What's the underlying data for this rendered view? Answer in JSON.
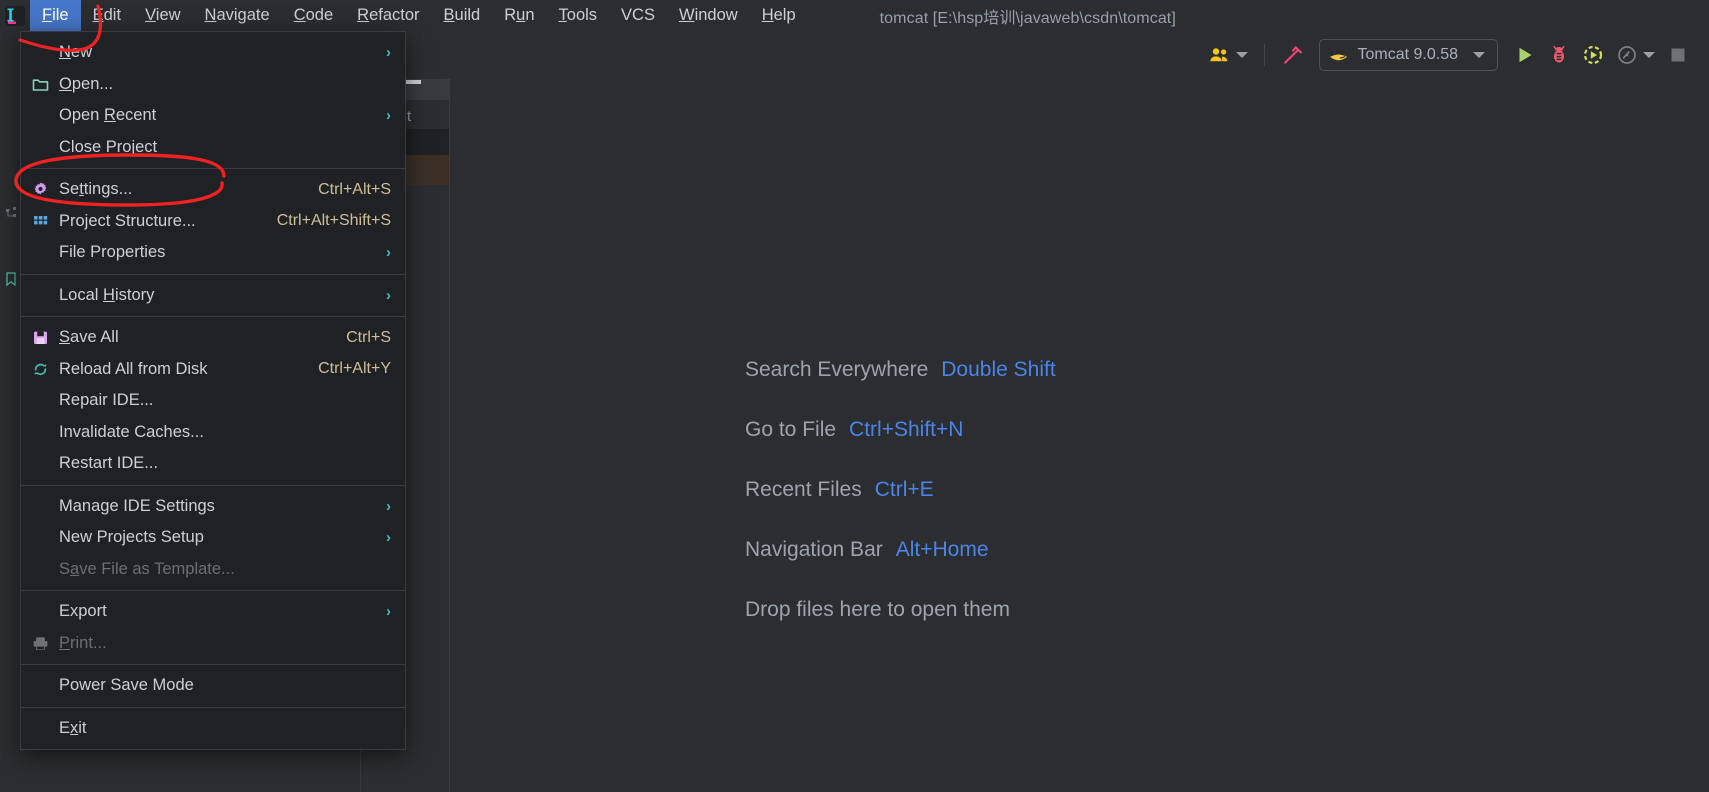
{
  "window": {
    "title": "tomcat [E:\\hsp培训\\javaweb\\csdn\\tomcat]",
    "app_logo_icon": "intellij-idea-logo-icon"
  },
  "menubar": {
    "items": [
      {
        "label": "File",
        "mnemonic": "F",
        "active": true
      },
      {
        "label": "Edit",
        "mnemonic": "E",
        "active": false
      },
      {
        "label": "View",
        "mnemonic": "V",
        "active": false
      },
      {
        "label": "Navigate",
        "mnemonic": "N",
        "active": false
      },
      {
        "label": "Code",
        "mnemonic": "C",
        "active": false
      },
      {
        "label": "Refactor",
        "mnemonic": "R",
        "active": false
      },
      {
        "label": "Build",
        "mnemonic": "B",
        "active": false
      },
      {
        "label": "Run",
        "mnemonic": "u",
        "active": false
      },
      {
        "label": "Tools",
        "mnemonic": "T",
        "active": false
      },
      {
        "label": "VCS",
        "mnemonic": "",
        "active": false
      },
      {
        "label": "Window",
        "mnemonic": "W",
        "active": false
      },
      {
        "label": "Help",
        "mnemonic": "H",
        "active": false
      }
    ]
  },
  "toolbar": {
    "collaborate_icon": "users-group-icon",
    "collaborate_caret": "chevron-down-icon",
    "build_icon": "hammer-build-icon",
    "run_configuration": {
      "icon": "tomcat-cat-icon",
      "label": "Tomcat 9.0.58",
      "caret": "chevron-down-icon"
    },
    "run_icon": "run-play-icon",
    "debug_icon": "debug-bug-icon",
    "run_with_coverage_icon": "run-coverage-icon",
    "profiler_icon": "profiler-gauge-icon",
    "profiler_caret": "chevron-down-icon",
    "stop_icon": "stop-square-icon"
  },
  "file_menu": {
    "items": [
      {
        "label": "New",
        "mnemonic": "N",
        "icon": "",
        "shortcut": "",
        "arrow": "›",
        "disabled": false
      },
      {
        "label": "Open...",
        "mnemonic": "O",
        "icon": "folder-icon",
        "shortcut": "",
        "arrow": "",
        "disabled": false
      },
      {
        "label": "Open Recent",
        "mnemonic": "R",
        "icon": "",
        "shortcut": "",
        "arrow": "›",
        "disabled": false
      },
      {
        "label": "Close Project",
        "mnemonic": "",
        "icon": "",
        "shortcut": "",
        "arrow": "",
        "disabled": false
      },
      {
        "separator": true
      },
      {
        "label": "Settings...",
        "mnemonic": "t",
        "icon": "gear-icon",
        "shortcut": "Ctrl+Alt+S",
        "arrow": "",
        "disabled": false
      },
      {
        "label": "Project Structure...",
        "mnemonic": "",
        "icon": "project-structure-grid-icon",
        "shortcut": "Ctrl+Alt+Shift+S",
        "arrow": "",
        "disabled": false
      },
      {
        "label": "File Properties",
        "mnemonic": "",
        "icon": "",
        "shortcut": "",
        "arrow": "›",
        "disabled": false
      },
      {
        "separator": true
      },
      {
        "label": "Local History",
        "mnemonic": "H",
        "icon": "",
        "shortcut": "",
        "arrow": "›",
        "disabled": false
      },
      {
        "separator": true
      },
      {
        "label": "Save All",
        "mnemonic": "S",
        "icon": "save-floppy-icon",
        "shortcut": "Ctrl+S",
        "arrow": "",
        "disabled": false
      },
      {
        "label": "Reload All from Disk",
        "mnemonic": "",
        "icon": "reload-sync-icon",
        "shortcut": "Ctrl+Alt+Y",
        "arrow": "",
        "disabled": false
      },
      {
        "label": "Repair IDE...",
        "mnemonic": "",
        "icon": "",
        "shortcut": "",
        "arrow": "",
        "disabled": false
      },
      {
        "label": "Invalidate Caches...",
        "mnemonic": "",
        "icon": "",
        "shortcut": "",
        "arrow": "",
        "disabled": false
      },
      {
        "label": "Restart IDE...",
        "mnemonic": "",
        "icon": "",
        "shortcut": "",
        "arrow": "",
        "disabled": false
      },
      {
        "separator": true
      },
      {
        "label": "Manage IDE Settings",
        "mnemonic": "",
        "icon": "",
        "shortcut": "",
        "arrow": "›",
        "disabled": false
      },
      {
        "label": "New Projects Setup",
        "mnemonic": "",
        "icon": "",
        "shortcut": "",
        "arrow": "›",
        "disabled": false
      },
      {
        "label": "Save File as Template...",
        "mnemonic": "a",
        "icon": "",
        "shortcut": "",
        "arrow": "",
        "disabled": true
      },
      {
        "separator": true
      },
      {
        "label": "Export",
        "mnemonic": "",
        "icon": "",
        "shortcut": "",
        "arrow": "›",
        "disabled": false
      },
      {
        "label": "Print...",
        "mnemonic": "P",
        "icon": "printer-icon",
        "shortcut": "",
        "arrow": "",
        "disabled": true
      },
      {
        "separator": true
      },
      {
        "label": "Power Save Mode",
        "mnemonic": "",
        "icon": "",
        "shortcut": "",
        "arrow": "",
        "disabled": false
      },
      {
        "separator": true
      },
      {
        "label": "Exit",
        "mnemonic": "x",
        "icon": "",
        "shortcut": "",
        "arrow": "",
        "disabled": false
      }
    ]
  },
  "editor_hints": [
    {
      "label": "Search Everywhere",
      "key": "Double Shift"
    },
    {
      "label": "Go to File",
      "key": "Ctrl+Shift+N"
    },
    {
      "label": "Recent Files",
      "key": "Ctrl+E"
    },
    {
      "label": "Navigation Bar",
      "key": "Alt+Home"
    },
    {
      "label": "Drop files here to open them",
      "key": ""
    }
  ],
  "annotations": {
    "settings_highlight_color": "#ee2222",
    "menubar_stroke_color": "#ee2222"
  },
  "colors": {
    "background": "#2b2d30",
    "menu_background": "#1f2124",
    "accent_blue": "#4676c8",
    "hint_key": "#4b85e8",
    "shortcut": "#cdbf9a",
    "submenu_arrow": "#49b8c4"
  }
}
